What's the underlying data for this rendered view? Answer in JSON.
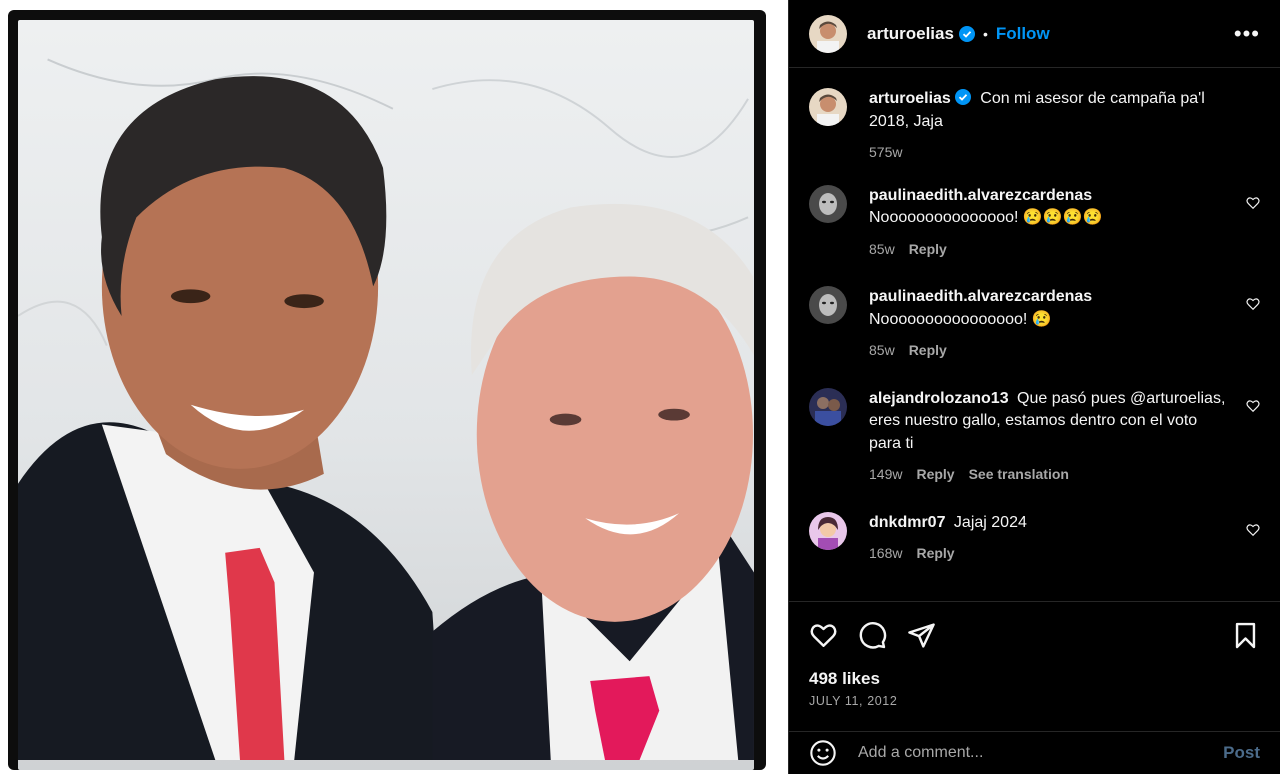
{
  "post": {
    "author": "arturoelias",
    "follow_label": "Follow",
    "caption": {
      "username": "arturoelias",
      "text": "Con mi asesor de campaña pa'l 2018, Jaja",
      "time": "575w"
    },
    "likes": "498 likes",
    "date": "JULY 11, 2012"
  },
  "comments": [
    {
      "username": "paulinaedith.alvarezcardenas",
      "text": "Nooooooooooooooo! 😢😢😢😢",
      "time": "85w",
      "reply_label": "Reply",
      "avatar_color": "#555555"
    },
    {
      "username": "paulinaedith.alvarezcardenas",
      "text": "Noooooooooooooooo! 😢",
      "time": "85w",
      "reply_label": "Reply",
      "avatar_color": "#555555"
    },
    {
      "username": "alejandrolozano13",
      "text": "Que pasó pues @arturoelias, eres nuestro gallo, estamos dentro con el voto para ti",
      "time": "149w",
      "reply_label": "Reply",
      "translate_label": "See translation",
      "avatar_color": "#3b3e6a"
    },
    {
      "username": "dnkdmr07",
      "text": "Jajaj 2024",
      "time": "168w",
      "reply_label": "Reply",
      "avatar_color": "#d9a3d8"
    }
  ],
  "comment_box": {
    "placeholder": "Add a comment...",
    "post_label": "Post"
  },
  "icons": {
    "more": "more-options-icon",
    "like": "heart-icon",
    "comment": "comment-icon",
    "share": "share-icon",
    "save": "bookmark-icon",
    "emoji": "emoji-icon",
    "verified": "verified-badge-icon"
  },
  "colors": {
    "background": "#000000",
    "accent": "#0095f6",
    "muted": "#a8a8a8",
    "divider": "#262626"
  }
}
